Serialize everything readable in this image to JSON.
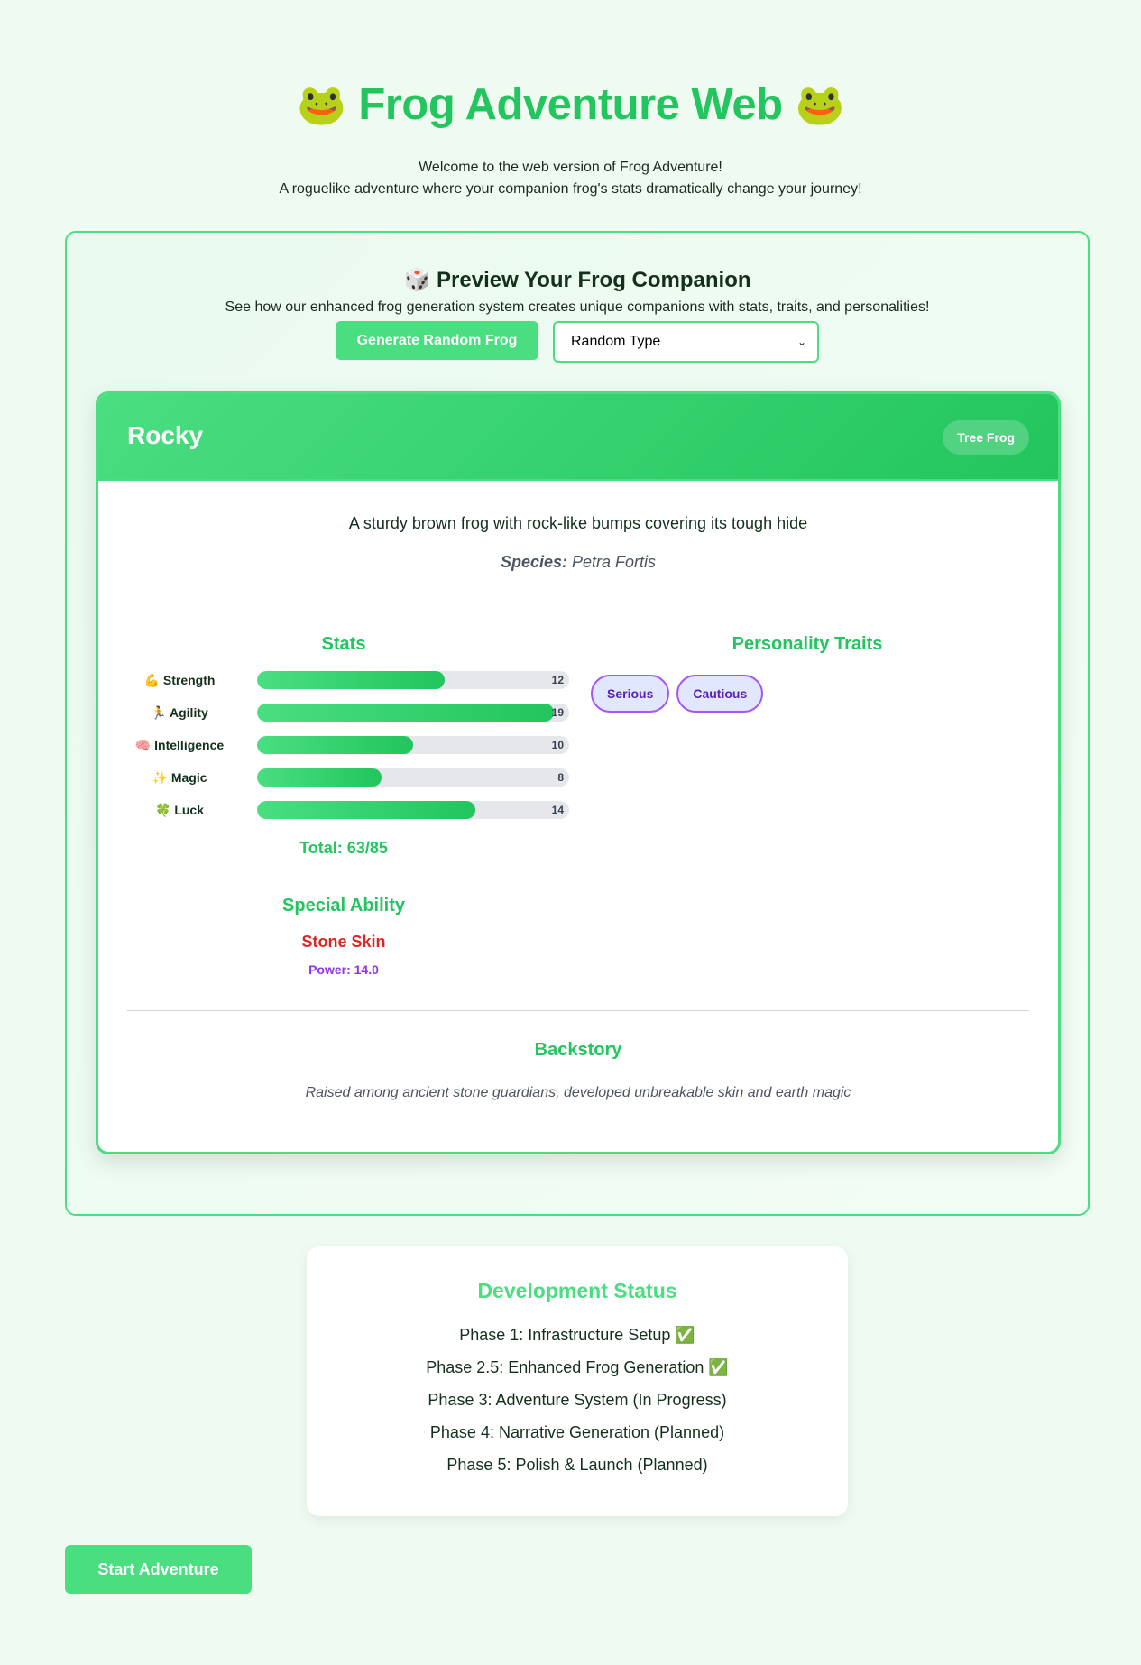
{
  "header": {
    "title": "Frog Adventure Web",
    "frog_icon": "🐸",
    "intro_line1": "Welcome to the web version of Frog Adventure!",
    "intro_line2": "A roguelike adventure where your companion frog's stats dramatically change your journey!"
  },
  "preview": {
    "title": "🎲 Preview Your Frog Companion",
    "description": "See how our enhanced frog generation system creates unique companions with stats, traits, and personalities!",
    "generate_button": "Generate Random Frog",
    "type_select": {
      "selected": "Random Type"
    }
  },
  "frog": {
    "name": "Rocky",
    "type": "Tree Frog",
    "description": "A sturdy brown frog with rock-like bumps covering its tough hide",
    "species_label": "Species:",
    "species": "Petra Fortis",
    "stats_heading": "Stats",
    "stats": [
      {
        "label": "💪 Strength",
        "value": "12"
      },
      {
        "label": "🏃 Agility",
        "value": "19"
      },
      {
        "label": "🧠 Intelligence",
        "value": "10"
      },
      {
        "label": "✨ Magic",
        "value": "8"
      },
      {
        "label": "🍀 Luck",
        "value": "14"
      }
    ],
    "stat_max": 20,
    "total": "Total: 63/85",
    "ability_heading": "Special Ability",
    "ability_name": "Stone Skin",
    "ability_power": "Power: 14.0",
    "traits_heading": "Personality Traits",
    "traits": [
      "Serious",
      "Cautious"
    ],
    "backstory_heading": "Backstory",
    "backstory": "Raised among ancient stone guardians, developed unbreakable skin and earth magic"
  },
  "dev_status": {
    "heading": "Development Status",
    "items": [
      "Phase 1: Infrastructure Setup ✅",
      "Phase 2.5: Enhanced Frog Generation ✅",
      "Phase 3: Adventure System (In Progress)",
      "Phase 4: Narrative Generation (Planned)",
      "Phase 5: Polish & Launch (Planned)"
    ]
  },
  "start_button": "Start Adventure",
  "colors": {
    "accent": "#22c55e",
    "accent_light": "#4ade80",
    "ability": "#dc2626",
    "power": "#9333ea",
    "trait_border": "#a855f7",
    "background": "#effbf1"
  }
}
